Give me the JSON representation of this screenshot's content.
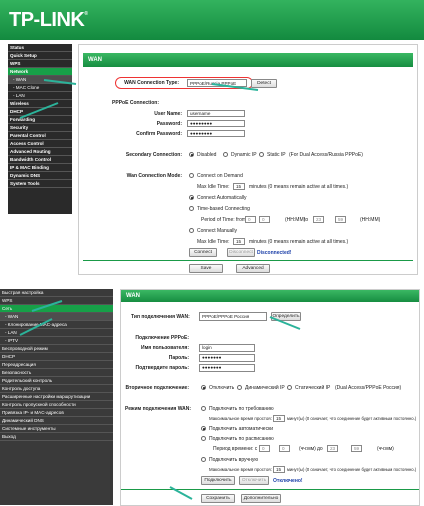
{
  "brand": {
    "logo": "TP-LINK",
    "tm": "®"
  },
  "en": {
    "sidebar": [
      {
        "label": "Status",
        "sub": false,
        "active": false
      },
      {
        "label": "Quick Setup",
        "sub": false,
        "active": false
      },
      {
        "label": "WPS",
        "sub": false,
        "active": false
      },
      {
        "label": "Network",
        "sub": false,
        "active": true
      },
      {
        "label": "- WAN",
        "sub": true,
        "active": true
      },
      {
        "label": "- MAC Clone",
        "sub": true,
        "active": false
      },
      {
        "label": "- LAN",
        "sub": true,
        "active": false
      },
      {
        "label": "Wireless",
        "sub": false,
        "active": false
      },
      {
        "label": "DHCP",
        "sub": false,
        "active": false
      },
      {
        "label": "Forwarding",
        "sub": false,
        "active": false
      },
      {
        "label": "Security",
        "sub": false,
        "active": false
      },
      {
        "label": "Parental Control",
        "sub": false,
        "active": false
      },
      {
        "label": "Access Control",
        "sub": false,
        "active": false
      },
      {
        "label": "Advanced Routing",
        "sub": false,
        "active": false
      },
      {
        "label": "Bandwidth Control",
        "sub": false,
        "active": false
      },
      {
        "label": "IP & MAC Binding",
        "sub": false,
        "active": false
      },
      {
        "label": "Dynamic DNS",
        "sub": false,
        "active": false
      },
      {
        "label": "System Tools",
        "sub": false,
        "active": false
      }
    ],
    "title": "WAN",
    "wan_type_label": "WAN Connection Type:",
    "wan_type_value": "PPPoE/Russia PPPoE",
    "detect": "Detect",
    "pppoe_heading": "PPPoE Connection:",
    "username_label": "User Name:",
    "username_value": "username",
    "password_label": "Password:",
    "password_value": "●●●●●●●●",
    "confirm_label": "Confirm Password:",
    "confirm_value": "●●●●●●●●",
    "secondary_label": "Secondary Connection:",
    "sec_disabled": "Disabled",
    "sec_dynamic": "Dynamic IP",
    "sec_static": "Static IP",
    "sec_note": "(For Dual Access/Russia PPPoE)",
    "mode_label": "Wan Connection Mode:",
    "mode_demand": "Connect on Demand",
    "idle_label": "Max Idle Time:",
    "idle_value": "15",
    "idle_note": "minutes (0 means remain active at all times.)",
    "mode_auto": "Connect Automatically",
    "mode_time": "Time-based Connecting",
    "period_label": "Period of Time: from",
    "t1": "0",
    "t2": "0",
    "t3": "23",
    "t4": "59",
    "hhmm": "(HH:MM)",
    "to": "to",
    "mode_manual": "Connect Manually",
    "idle2_value": "15",
    "connect": "Connect",
    "disconnect": "Disconnect",
    "status": "Disconnected!",
    "save": "Save",
    "advanced": "Advanced"
  },
  "ru": {
    "sidebar": [
      {
        "label": "Быстрая настройка",
        "sub": false,
        "active": false
      },
      {
        "label": "WPS",
        "sub": false,
        "active": false
      },
      {
        "label": "Сеть",
        "sub": false,
        "active": true
      },
      {
        "label": "- WAN",
        "sub": true,
        "active": true
      },
      {
        "label": "- Клонирование MAC-адреса",
        "sub": true,
        "active": false
      },
      {
        "label": "- LAN",
        "sub": true,
        "active": false
      },
      {
        "label": "- IPTV",
        "sub": true,
        "active": false
      },
      {
        "label": "Беспроводной режим",
        "sub": false,
        "active": false
      },
      {
        "label": "DHCP",
        "sub": false,
        "active": false
      },
      {
        "label": "Переадресация",
        "sub": false,
        "active": false
      },
      {
        "label": "Безопасность",
        "sub": false,
        "active": false
      },
      {
        "label": "Родительский контроль",
        "sub": false,
        "active": false
      },
      {
        "label": "Контроль доступа",
        "sub": false,
        "active": false
      },
      {
        "label": "Расширенные настройки маршрутизации",
        "sub": false,
        "active": false
      },
      {
        "label": "Контроль пропускной способности",
        "sub": false,
        "active": false
      },
      {
        "label": "Привязка IP- и MAC-адресов",
        "sub": false,
        "active": false
      },
      {
        "label": "Динамический DNS",
        "sub": false,
        "active": false
      },
      {
        "label": "Системные инструменты",
        "sub": false,
        "active": false
      },
      {
        "label": "Выход",
        "sub": false,
        "active": false
      }
    ],
    "title": "WAN",
    "wan_type_label": "Тип подключения WAN:",
    "wan_type_value": "PPPoE/PPPoE Россия",
    "detect": "Определить",
    "pppoe_heading": "Подключение PPPoE:",
    "username_label": "Имя пользователя:",
    "username_value": "login",
    "password_label": "Пароль:",
    "password_value": "●●●●●●●",
    "confirm_label": "Подтвердите пароль:",
    "confirm_value": "●●●●●●●",
    "secondary_label": "Вторичное подключение:",
    "sec_disabled": "Отключить",
    "sec_dynamic": "Динамический IP",
    "sec_static": "Статический IP",
    "sec_note": "(Dual Access/PPPoE Россия)",
    "mode_label": "Режим подключения WAN:",
    "mode_demand": "Подключить по требованию",
    "idle_label": "Максимальное время простоя:",
    "idle_value": "15",
    "idle_note": "минут(ы) (0 означает, что соединение будет активным постоянно.)",
    "mode_auto": "Подключить автоматически",
    "mode_time": "Подключить по расписанию",
    "period_label": "Период времени: с",
    "t1": "0",
    "t2": "0",
    "t3": "23",
    "t4": "59",
    "hhmm": "(чч:мм)",
    "to": "до",
    "mode_manual": "Подключить вручную",
    "idle2_value": "15",
    "connect": "Подключить",
    "disconnect": "Отключить",
    "status": "Отключено!",
    "save": "Сохранить",
    "advanced": "Дополнительно"
  }
}
